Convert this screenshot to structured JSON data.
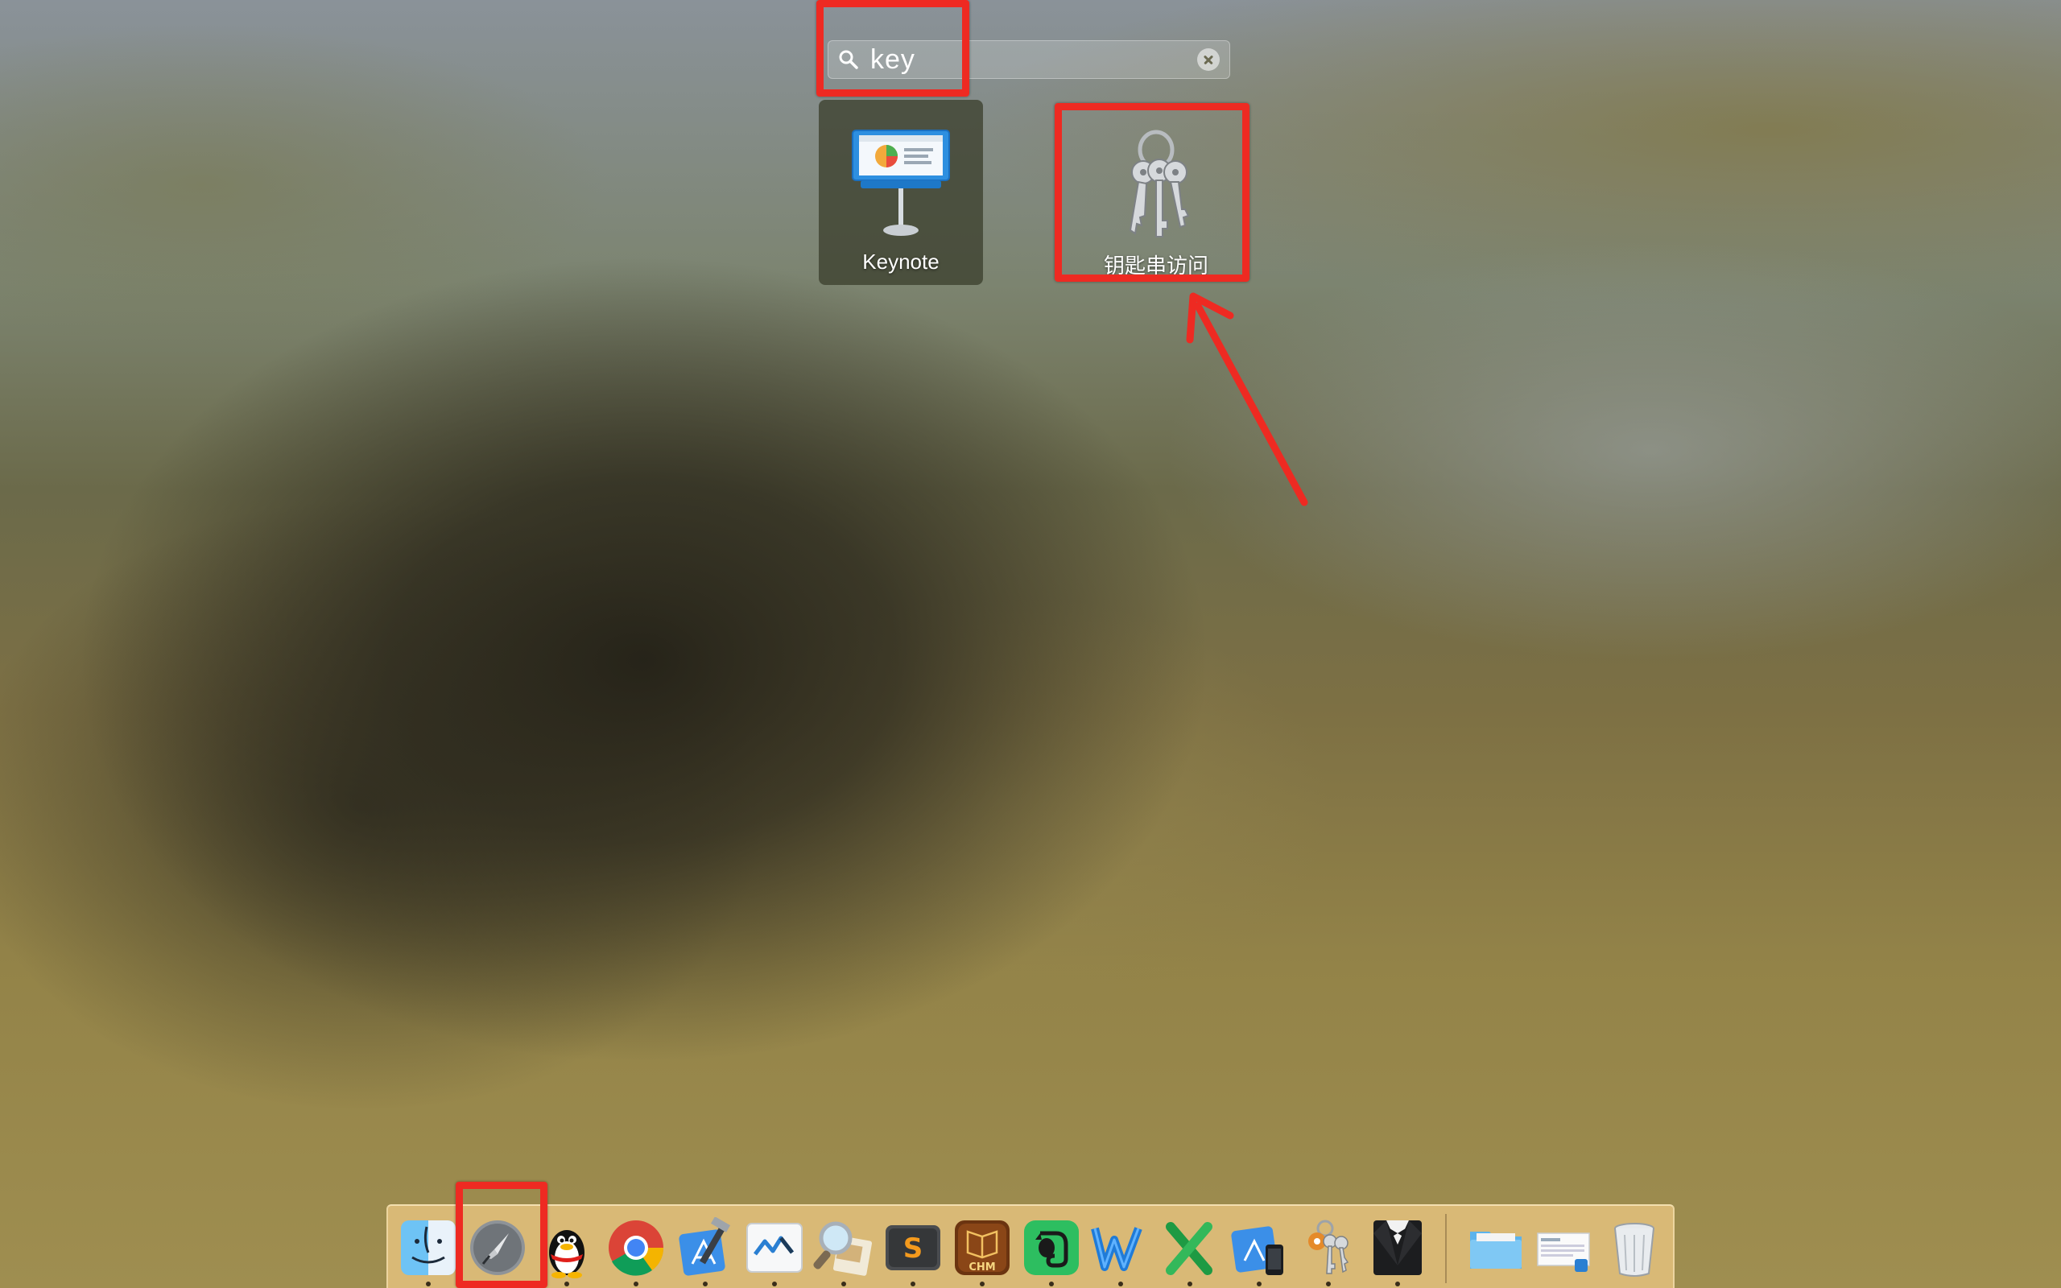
{
  "search": {
    "value": "key"
  },
  "apps": [
    {
      "label": "Keynote",
      "icon": "keynote-icon",
      "selected": true
    },
    {
      "label": "钥匙串访问",
      "icon": "keychain-access-icon",
      "selected": false
    }
  ],
  "dock": {
    "items": [
      {
        "name": "Finder",
        "icon": "finder-icon",
        "running": true
      },
      {
        "name": "Launchpad",
        "icon": "launchpad-icon",
        "running": true
      },
      {
        "name": "QQ",
        "icon": "qq-penguin-icon",
        "running": true
      },
      {
        "name": "Google Chrome",
        "icon": "chrome-icon",
        "running": true
      },
      {
        "name": "Xcode",
        "icon": "xcode-icon",
        "running": true
      },
      {
        "name": "WebStorm",
        "icon": "webstorm-icon",
        "running": true
      },
      {
        "name": "Preview",
        "icon": "preview-icon",
        "running": true
      },
      {
        "name": "Sublime Text",
        "icon": "sublime-text-icon",
        "running": true
      },
      {
        "name": "CHM Viewer",
        "icon": "chm-viewer-icon",
        "running": true
      },
      {
        "name": "Evernote",
        "icon": "evernote-icon",
        "running": true
      },
      {
        "name": "Microsoft Word",
        "icon": "word-icon",
        "running": true
      },
      {
        "name": "Microsoft Excel",
        "icon": "excel-icon",
        "running": true
      },
      {
        "name": "Simulator",
        "icon": "simulator-icon",
        "running": true
      },
      {
        "name": "Keychain Access",
        "icon": "keychain-small-icon",
        "running": true
      },
      {
        "name": "Bartender",
        "icon": "bartender-icon",
        "running": true
      },
      {
        "name": "Folder",
        "icon": "folder-icon",
        "running": false
      },
      {
        "name": "Screenshot",
        "icon": "screenshot-stack-icon",
        "running": false
      },
      {
        "name": "Trash",
        "icon": "trash-icon",
        "running": false
      }
    ],
    "chm_label": "CHM",
    "sublime_letter": "S"
  },
  "colors": {
    "annotation": "#ee2a22"
  }
}
